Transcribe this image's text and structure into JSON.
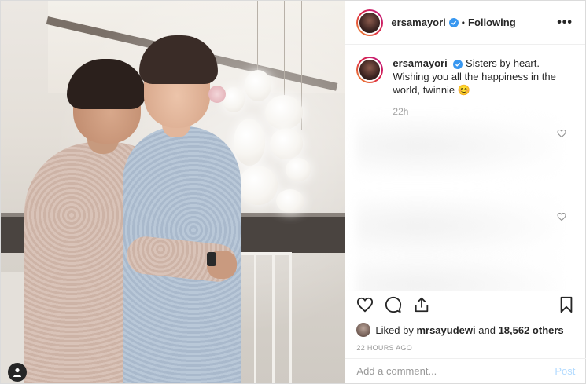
{
  "header": {
    "username": "ersamayori",
    "separator": "•",
    "follow_status": "Following",
    "more_label": "•••"
  },
  "caption": {
    "username": "ersamayori",
    "text": "Sisters by heart. Wishing you all the happiness in the world, twinnie 😊",
    "time": "22h"
  },
  "likes": {
    "prefix": "Liked by",
    "user": "mrsayudewi",
    "joiner": "and",
    "others": "18,562 others"
  },
  "post_time": "22 HOURS AGO",
  "comment": {
    "placeholder": "Add a comment...",
    "post_label": "Post"
  },
  "icons": {
    "like": "heart-icon",
    "comment": "comment-icon",
    "share": "share-icon",
    "save": "bookmark-icon",
    "verified": "verified-badge-icon",
    "user_tag": "user-icon"
  },
  "colors": {
    "verified_blue": "#3897f0",
    "post_button": "#b3dbff",
    "muted_text": "#999999"
  }
}
